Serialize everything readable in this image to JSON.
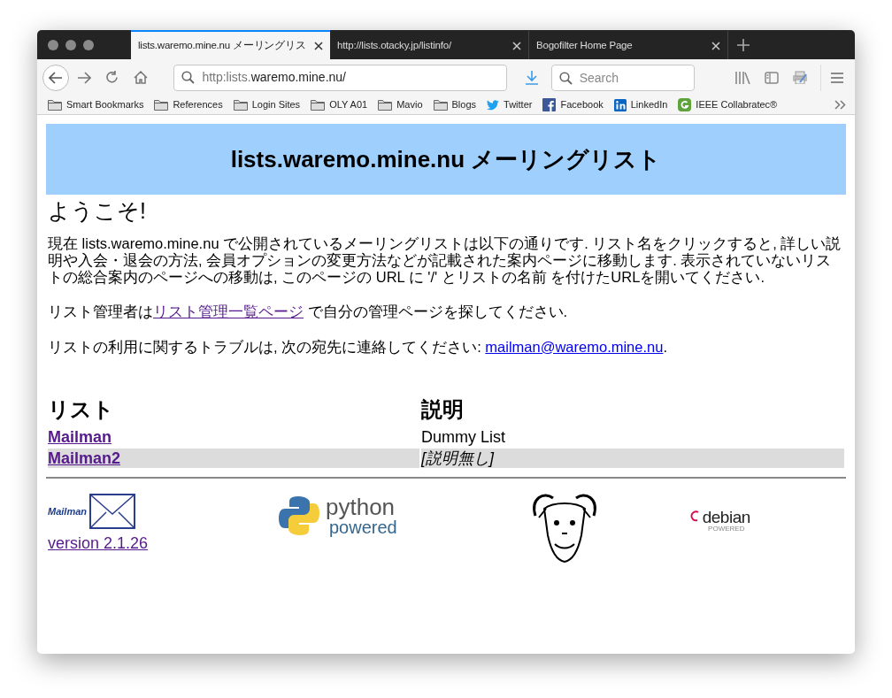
{
  "tabs": [
    {
      "label": "lists.waremo.mine.nu メーリングリス",
      "selected": true
    },
    {
      "label": "http://lists.otacky.jp/listinfo/",
      "selected": false
    },
    {
      "label": "Bogofilter Home Page",
      "selected": false
    }
  ],
  "address": {
    "prefix": "http:lists.",
    "host": "waremo.mine.nu/"
  },
  "search": {
    "placeholder": "Search"
  },
  "bookmarks": [
    {
      "kind": "folder",
      "label": "Smart Bookmarks"
    },
    {
      "kind": "folder",
      "label": "References"
    },
    {
      "kind": "folder",
      "label": "Login Sites"
    },
    {
      "kind": "folder",
      "label": "OLY A01"
    },
    {
      "kind": "folder",
      "label": "Mavio"
    },
    {
      "kind": "folder",
      "label": "Blogs"
    },
    {
      "kind": "twitter",
      "label": "Twitter"
    },
    {
      "kind": "facebook",
      "label": "Facebook"
    },
    {
      "kind": "linkedin",
      "label": "LinkedIn"
    },
    {
      "kind": "ieee",
      "label": "IEEE Collabratec®"
    }
  ],
  "page": {
    "banner": "lists.waremo.mine.nu メーリングリスト",
    "heading": "ようこそ!",
    "intro": "現在 lists.waremo.mine.nu で公開されているメーリングリストは以下の通りです. リスト名をクリックすると, 詳しい説明や入会・退会の方法, 会員オプションの変更方法などが記載された案内ページに移動します. 表示されていないリストの総合案内のページへの移動は, このページの URL に '/' とリストの名前 を付けたURLを開いてください.",
    "admin": {
      "before": "リスト管理者は",
      "link": "リスト管理一覧ページ",
      "after": " で自分の管理ページを探してください."
    },
    "contact": {
      "before": "リストの利用に関するトラブルは, 次の宛先に連絡してください: ",
      "link": "mailman@waremo.mine.nu",
      "after": "."
    },
    "table": {
      "columns": [
        "リスト",
        "説明"
      ],
      "rows": [
        {
          "name": "Mailman",
          "description": "Dummy List",
          "no_description": false
        },
        {
          "name": "Mailman2",
          "description": "[説明無し]",
          "no_description": true
        }
      ]
    },
    "footer": {
      "mailman_logo": "Mailman",
      "version": "version 2.1.26",
      "python": [
        "python",
        "powered"
      ],
      "debian": [
        "debian",
        "POWERED"
      ]
    }
  }
}
